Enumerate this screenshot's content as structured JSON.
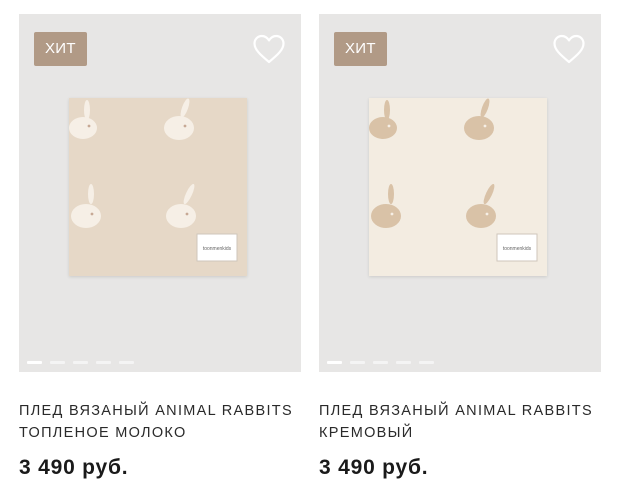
{
  "products": [
    {
      "badge": "ХИТ",
      "title": "ПЛЕД ВЯЗАНЫЙ ANIMAL RABBITS ТОПЛЕНОЕ МОЛОКО",
      "price": "3 490 руб.",
      "blanket_color": "#e6d8c7",
      "rabbit_color": "#f6efe6",
      "label_text": "toonmenkids",
      "slides": 5,
      "active_slide": 1
    },
    {
      "badge": "ХИТ",
      "title": "ПЛЕД ВЯЗАНЫЙ ANIMAL RABBITS КРЕМОВЫЙ",
      "price": "3 490 руб.",
      "blanket_color": "#f3ece1",
      "rabbit_color": "#d9c2a7",
      "label_text": "toonmenkids",
      "slides": 5,
      "active_slide": 1
    }
  ],
  "colors": {
    "badge_bg": "#b19a86",
    "media_bg": "#e7e6e5"
  },
  "icons": {
    "favorite": "heart-outline-icon"
  }
}
